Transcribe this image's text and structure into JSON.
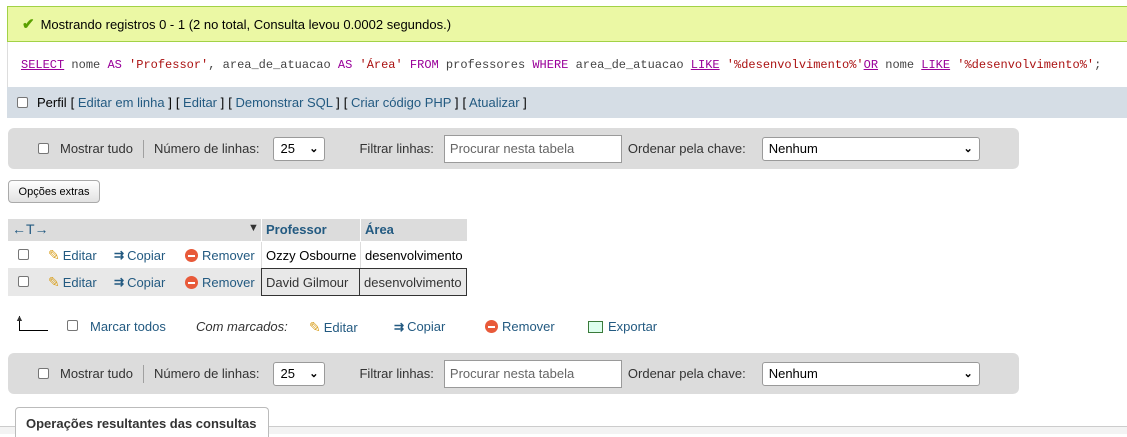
{
  "success_message": "Mostrando registros 0 - 1 (2 no total, Consulta levou 0.0002 segundos.)",
  "sql": {
    "select": "SELECT",
    "p1": " nome ",
    "as1": "AS",
    "s1": " 'Professor'",
    "p2": ", area_de_atuacao ",
    "as2": "AS",
    "s2": " 'Área'",
    "from": " FROM",
    "p3": " professores ",
    "where": "WHERE",
    "p4": " area_de_atuacao ",
    "like1": "LIKE",
    "s3": " '%desenvolvimento%'",
    "or": "OR",
    "p5": " nome ",
    "like2": "LIKE",
    "s4": " '%desenvolvimento%'",
    "end": ";"
  },
  "profile_bar": {
    "perfil": "Perfil",
    "links": [
      "Editar em linha",
      "Editar",
      "Demonstrar SQL",
      "Criar código PHP",
      "Atualizar"
    ]
  },
  "nav": {
    "show_all": "Mostrar tudo",
    "rows_label": "Número de linhas:",
    "rows_value": "25",
    "filter_label": "Filtrar linhas:",
    "filter_placeholder": "Procurar nesta tabela",
    "sort_label": "Ordenar pela chave:",
    "sort_value": "Nenhum"
  },
  "extra_options": "Opções extras",
  "table": {
    "arrows": "←T→",
    "columns": [
      "Professor",
      "Área"
    ],
    "actions": {
      "edit": "Editar",
      "copy": "Copiar",
      "remove": "Remover"
    },
    "rows": [
      {
        "professor": "Ozzy Osbourne",
        "area": "desenvolvimento"
      },
      {
        "professor": "David Gilmour",
        "area": "desenvolvimento"
      }
    ]
  },
  "bulk": {
    "check_all": "Marcar todos",
    "with_selected": "Com marcados:",
    "edit": "Editar",
    "copy": "Copiar",
    "remove": "Remover",
    "export": "Exportar"
  },
  "footer_tab": "Operações resultantes das consultas",
  "colors": {
    "success_bg": "#ebf8a4",
    "link": "#235a81",
    "header_bg": "#dcdcdc"
  }
}
